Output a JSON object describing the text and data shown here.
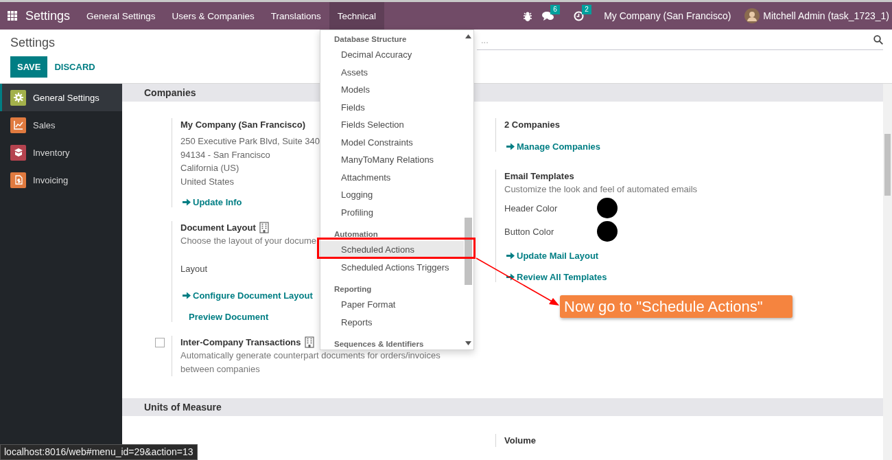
{
  "navbar": {
    "app_title": "Settings",
    "menus": [
      {
        "label": "General Settings",
        "selected": false
      },
      {
        "label": "Users & Companies",
        "selected": false
      },
      {
        "label": "Translations",
        "selected": false
      },
      {
        "label": "Technical",
        "selected": true
      }
    ],
    "messages_count": "6",
    "activities_count": "2",
    "company": "My Company (San Francisco)",
    "user": "Mitchell Admin (task_1723_1)"
  },
  "control_panel": {
    "title": "Settings",
    "buttons": [
      {
        "label": "SAVE",
        "kind": "primary"
      },
      {
        "label": "DISCARD",
        "kind": "secondary"
      }
    ],
    "search": {
      "placeholder": "..."
    }
  },
  "sidebar": {
    "items": [
      {
        "label": "General Settings",
        "color": "#a3b14b",
        "selected": true
      },
      {
        "label": "Sales",
        "color": "#e07a3f",
        "selected": false
      },
      {
        "label": "Inventory",
        "color": "#b5434f",
        "selected": false
      },
      {
        "label": "Invoicing",
        "color": "#e07a3f",
        "selected": false
      }
    ]
  },
  "sections": [
    {
      "title": "Companies",
      "columns": [
        [
          {
            "title": "My Company (San Francisco)",
            "lines": [
              "250 Executive Park Blvd, Suite 340",
              "94134 - San Francisco",
              "California (US)",
              "United States"
            ],
            "link_rows": [
              [
                {
                  "label": "Update Info",
                  "arrow": true
                }
              ]
            ]
          },
          {
            "title": "Document Layout",
            "building_icon": true,
            "description": "Choose the layout of your docume",
            "field": "Layout",
            "link_rows": [
              [
                {
                  "label": "Configure Document Layout",
                  "arrow": true
                }
              ],
              [
                {
                  "label": "Preview Document",
                  "arrow": false
                }
              ]
            ]
          },
          {
            "title": "Inter-Company Transactions",
            "building_icon": true,
            "checkbox": {
              "checked": false
            },
            "description": "Automatically generate counterpart documents for orders/invoices between companies"
          }
        ],
        [
          {
            "title": "2 Companies",
            "link_rows": [
              [
                {
                  "label": "Manage Companies",
                  "arrow": true
                }
              ]
            ]
          },
          {
            "title": "Email Templates",
            "description": "Customize the look and feel of automated emails",
            "colors": [
              {
                "label": "Header Color",
                "color": "#000000"
              },
              {
                "label": "Button Color",
                "color": "#000000"
              }
            ],
            "link_rows": [
              [
                {
                  "label": "Update Mail Layout",
                  "arrow": true
                }
              ],
              [
                {
                  "label": "Review All Templates",
                  "arrow": true
                }
              ]
            ]
          }
        ]
      ]
    },
    {
      "title": "Units of Measure",
      "columns": [
        [],
        [
          {
            "title": "Volume"
          }
        ]
      ]
    }
  ],
  "dropdown": {
    "groups": [
      {
        "title": "Database Structure",
        "items": [
          {
            "label": "Decimal Accuracy",
            "selected": false
          },
          {
            "label": "Assets",
            "selected": false
          },
          {
            "label": "Models",
            "selected": false
          },
          {
            "label": "Fields",
            "selected": false
          },
          {
            "label": "Fields Selection",
            "selected": false
          },
          {
            "label": "Model Constraints",
            "selected": false
          },
          {
            "label": "ManyToMany Relations",
            "selected": false
          },
          {
            "label": "Attachments",
            "selected": false
          },
          {
            "label": "Logging",
            "selected": false
          },
          {
            "label": "Profiling",
            "selected": false
          }
        ]
      },
      {
        "title": "Automation",
        "items": [
          {
            "label": "Scheduled Actions",
            "selected": true
          },
          {
            "label": "Scheduled Actions Triggers",
            "selected": false
          }
        ]
      },
      {
        "title": "Reporting",
        "items": [
          {
            "label": "Paper Format",
            "selected": false
          },
          {
            "label": "Reports",
            "selected": false
          }
        ]
      },
      {
        "title": "Sequences & Identifiers"
      }
    ]
  },
  "annotation": {
    "callout": "Now go to \"Schedule Actions\""
  },
  "status_url": "localhost:8016/web#menu_id=29&action=13"
}
